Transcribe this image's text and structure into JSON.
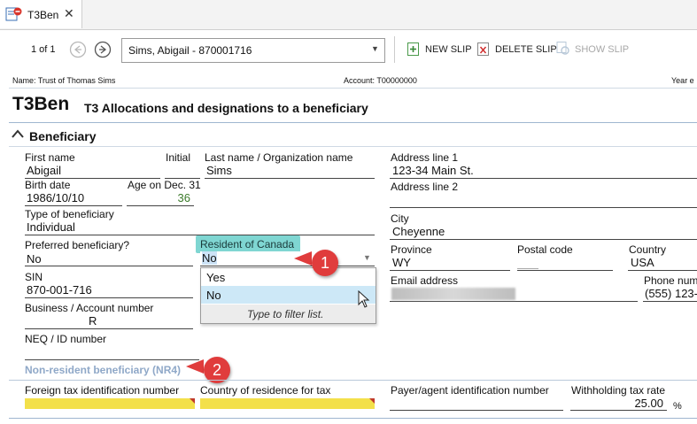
{
  "tab": {
    "label": "T3Ben"
  },
  "toolbar": {
    "pager": "1 of 1",
    "recipient_select": "Sims, Abigail - 870001716",
    "new_slip": "NEW SLIP",
    "delete_slip": "DELETE SLIP",
    "show_slip": "SHOW SLIP"
  },
  "info": {
    "name": "Name: Trust of Thomas Sims",
    "account": "Account: T00000000",
    "year": "Year e"
  },
  "form": {
    "code": "T3Ben",
    "title": "T3 Allocations and designations to a beneficiary"
  },
  "section": {
    "beneficiary": "Beneficiary",
    "nr4": "Non-resident beneficiary (NR4)"
  },
  "fields": {
    "first_name_label": "First name",
    "first_name": "Abigail",
    "initial_label": "Initial",
    "initial": "",
    "last_name_label": "Last name / Organization name",
    "last_name": "Sims",
    "birth_date_label": "Birth date",
    "birth_date": "1986/10/10",
    "age_label": "Age on Dec. 31",
    "age": "36",
    "type_label": "Type of beneficiary",
    "type": "Individual",
    "preferred_label": "Preferred beneficiary?",
    "preferred": "No",
    "resident_label": "Resident of Canada",
    "resident": "No",
    "sin_label": "SIN",
    "sin": "870-001-716",
    "business_label": "Business / Account number",
    "business": "R",
    "neq_label": "NEQ / ID number",
    "neq": "",
    "addr1_label": "Address line 1",
    "addr1": "123-34 Main St.",
    "addr2_label": "Address line 2",
    "addr2": "",
    "city_label": "City",
    "city": "Cheyenne",
    "province_label": "Province",
    "province": "WY",
    "postal_label": "Postal code",
    "postal": "",
    "country_label": "Country",
    "country": "USA",
    "email_label": "Email address",
    "phone_label": "Phone num",
    "phone": "(555) 123-",
    "foreign_tax_label": "Foreign tax identification number",
    "country_res_label": "Country of residence for tax",
    "payer_label": "Payer/agent identification number",
    "withholding_label": "Withholding tax rate",
    "withholding": "25.00",
    "withholding_unit": "%"
  },
  "dropdown": {
    "options": [
      "Yes",
      "No"
    ],
    "hint": "Type to filter list."
  },
  "callouts": [
    "1",
    "2"
  ],
  "colors": {
    "accent": "#3f8fd0",
    "callout": "#e03c3c",
    "required": "#f3e04a",
    "tooltip": "#7fd6d2"
  }
}
